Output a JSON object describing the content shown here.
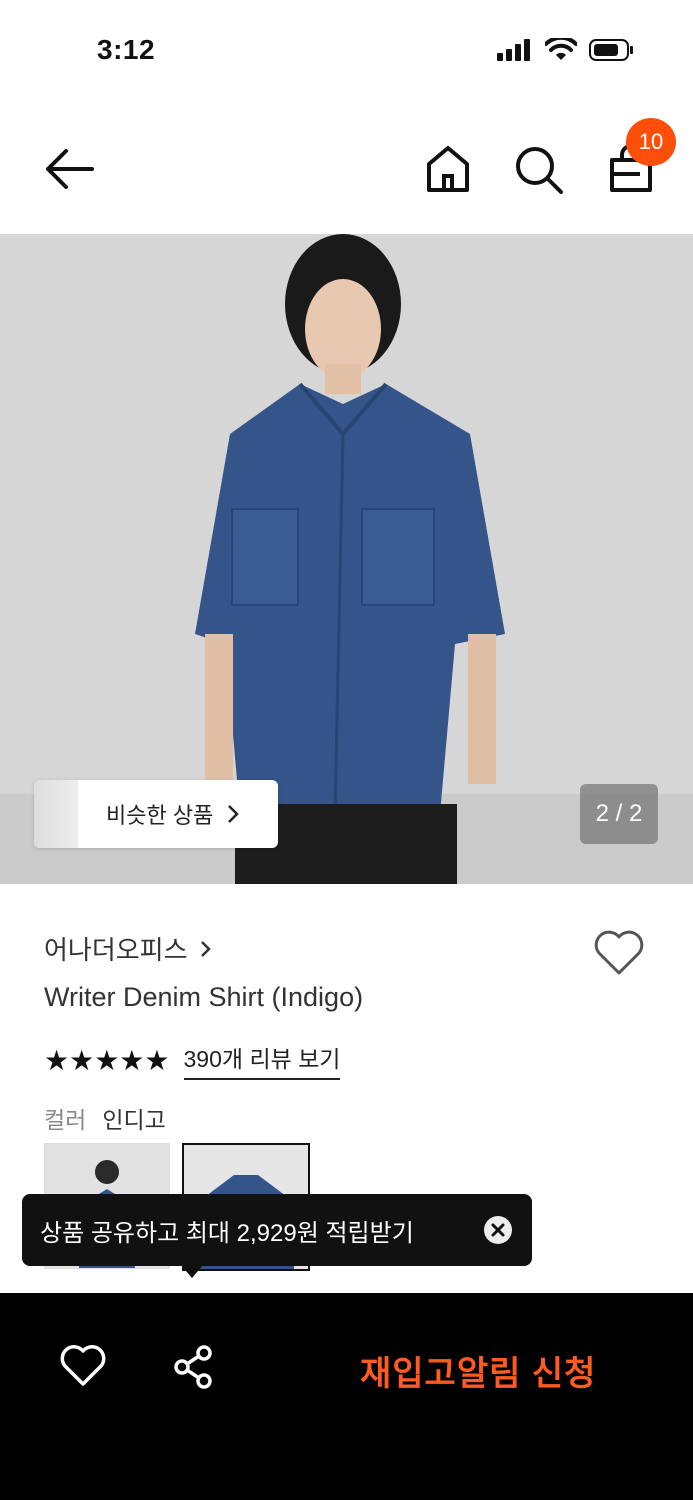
{
  "status_bar": {
    "time": "3:12"
  },
  "header": {
    "cart_count": "10"
  },
  "gallery": {
    "similar_label": "비슷한 상품",
    "page_indicator": "2 / 2"
  },
  "product": {
    "brand": "어나더오피스",
    "title": "Writer Denim Shirt (Indigo)",
    "stars": "★★★★★",
    "review_link": "390개 리뷰 보기",
    "color_label": "컬러",
    "color_value": "인디고"
  },
  "tooltip": {
    "text": "상품 공유하고 최대 2,929원 적립받기"
  },
  "bottom_bar": {
    "restock_label": "재입고알림 신청"
  },
  "colors": {
    "accent": "#ff5a1f",
    "badge": "#ff4d0a",
    "denim": "#34548a"
  }
}
